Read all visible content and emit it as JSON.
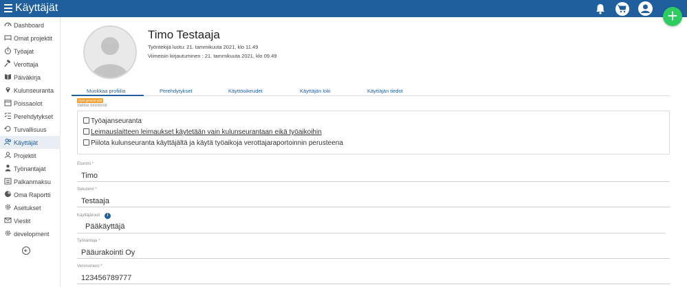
{
  "header": {
    "app_title": "Käyttäjät",
    "fab_label": "+",
    "icons": [
      "menu-icon",
      "bell-icon",
      "cart-icon",
      "user-icon"
    ]
  },
  "sidebar": {
    "items": [
      {
        "label": "Dashboard",
        "icon": "dashboard-icon"
      },
      {
        "label": "Omat projektit",
        "icon": "bed-icon"
      },
      {
        "label": "Työajat",
        "icon": "stopwatch-icon"
      },
      {
        "label": "Verottaja",
        "icon": "gavel-icon"
      },
      {
        "label": "Päiväkirja",
        "icon": "book-icon"
      },
      {
        "label": "Kulunseuranta",
        "icon": "map-marker-icon"
      },
      {
        "label": "Poissaolot",
        "icon": "calendar-icon"
      },
      {
        "label": "Perehdytykset",
        "icon": "checklist-icon"
      },
      {
        "label": "Turvallisuus",
        "icon": "history-icon"
      },
      {
        "label": "Käyttäjät",
        "icon": "users-icon",
        "active": true
      },
      {
        "label": "Projektit",
        "icon": "project-icon"
      },
      {
        "label": "Työnantajat",
        "icon": "employer-icon"
      },
      {
        "label": "Palkanmaksu",
        "icon": "payroll-icon"
      },
      {
        "label": "Oma Raportti",
        "icon": "pie-chart-icon"
      },
      {
        "label": "Asetukset",
        "icon": "gear-icon"
      },
      {
        "label": "Viestit",
        "icon": "envelope-icon"
      },
      {
        "label": "development",
        "icon": "cog-icon"
      }
    ]
  },
  "profile": {
    "name": "Timo Testaaja",
    "created": "Työntekijä luotu: 21. tammikuuta 2021, klo 11.49",
    "last_login": "Viimeisin kirjautuminen : 21. tammikuuta 2021, klo 09.49"
  },
  "tabs": [
    "Muokkaa profiilia",
    "Perehdytykset",
    "Käyttöoikeudet",
    "Käyttäjän loki",
    "Käyttäjän tiedot"
  ],
  "form": {
    "badge": "OLD general add",
    "options_label": "Valitse toiminnot",
    "options": [
      "Työajanseuranta",
      "Leimauslaitteen leimaukset käytetään vain kulunseurantaan eikä työaikoihin",
      "Piilota kulunseuranta käyttäjältä ja käytä työaikoja verottajaraportoinnin perusteena"
    ],
    "fields": [
      {
        "label": "Etunimi *",
        "value": "Timo"
      },
      {
        "label": "Sukunimi *",
        "value": "Testaaja"
      },
      {
        "label": "Käyttäjärooli",
        "value": "Pääkäyttäjä"
      },
      {
        "label": "Työnantaja *",
        "value": "Pääurakointi Oy"
      },
      {
        "label": "Veronumero *",
        "value": "123456789777"
      }
    ],
    "info_symbol": "i"
  },
  "colors": {
    "primary": "#1f5f9e",
    "fab": "#2ecc60",
    "badge": "#f0a030"
  }
}
